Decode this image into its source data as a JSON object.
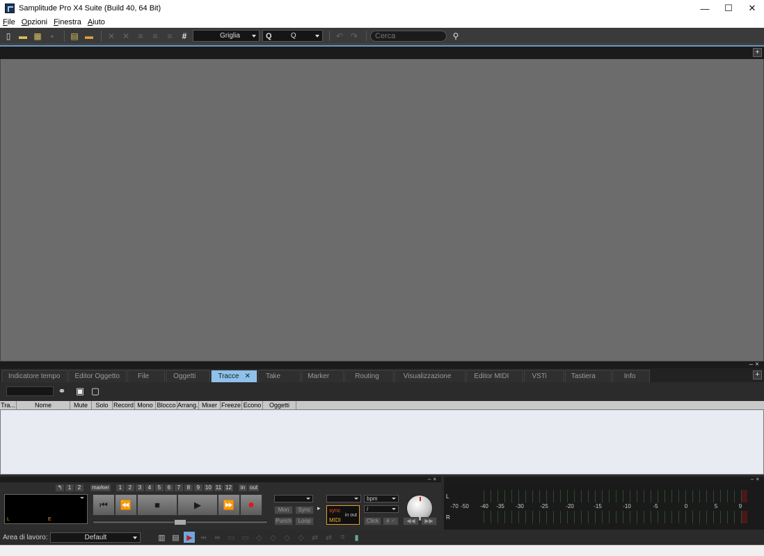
{
  "window": {
    "title": "Samplitude Pro X4 Suite (Build 40, 64 Bit)",
    "minimize_glyph": "—",
    "maximize_glyph": "☐",
    "close_glyph": "✕"
  },
  "menu": [
    "File",
    "Opzioni",
    "Finestra",
    "Aiuto"
  ],
  "toolbar": {
    "grid_combo": "Griglia",
    "q_label": "Q",
    "q_combo": "Q",
    "search_placeholder": "Cerca",
    "grid_glyph": "#"
  },
  "panel": {
    "tabs": [
      "Indicatore tempo",
      "Editor Oggetto",
      "File",
      "Oggetti",
      "Tracce",
      "Take",
      "Marker",
      "Routing",
      "Visualizzazione",
      "Editor MIDI",
      "VSTi",
      "Tastiera",
      "Info"
    ],
    "active_tab": "Tracce",
    "columns": [
      "Tra...",
      "Nome",
      "Mute",
      "Solo",
      "Record",
      "Mono",
      "Blocco",
      "Arrang...",
      "Mixer",
      "Freeze",
      "Econo",
      "Oggetti"
    ]
  },
  "transport": {
    "markers": [
      "↰",
      "1",
      "2",
      "marker",
      "1",
      "2",
      "3",
      "4",
      "5",
      "6",
      "7",
      "8",
      "9",
      "10",
      "11",
      "12",
      "in",
      "out"
    ],
    "lcd_left": "L",
    "lcd_e": "E",
    "buttons": {
      "mon": "Mon",
      "sync": "Sync",
      "punch": "Punch",
      "loop": "Loop",
      "click": "Click",
      "hash": "# ♂"
    },
    "sync_label": "sync",
    "midi_label": "MIDI",
    "in_label": "in",
    "out_label": "out",
    "bpm": "bpm",
    "slash": "/",
    "glyphs": {
      "start": "⏮",
      "rewind": "⏪",
      "stop": "■",
      "play": "▶",
      "ffwd": "⏩",
      "record": "●",
      "arrow": "▸",
      "left": "◀◀",
      "right": "▶▶"
    }
  },
  "meter": {
    "left_label": "L",
    "right_label": "R",
    "scale": [
      "-70",
      "-50",
      "-40",
      "-35",
      "-30",
      "-25",
      "-20",
      "-15",
      "-10",
      "-5",
      "0",
      "5",
      "9"
    ]
  },
  "bottom": {
    "workspace_label": "Area di lavoro:",
    "workspace_value": "Default"
  },
  "icons": {
    "plus": "+",
    "panel_min": "–",
    "panel_close": "×",
    "tab_close": "✕"
  }
}
